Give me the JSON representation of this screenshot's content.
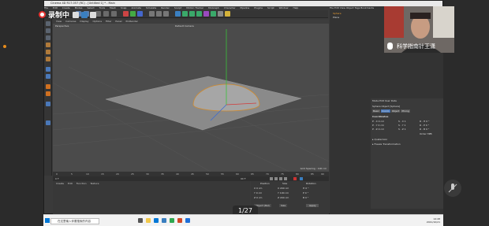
{
  "recorder": {
    "label": "录制中"
  },
  "app": {
    "title": "Cinema 4D R17.057 (RC) - [Untitled 1] * - Main",
    "menu": [
      "File",
      "Edit",
      "Create",
      "Modes",
      "Select",
      "Tools",
      "Mesh",
      "Snap",
      "Animate",
      "Simulate",
      "Render",
      "Sculpt",
      "Motion Tracker",
      "MoGraph",
      "Character",
      "Pipeline",
      "Plugins",
      "Script",
      "Window",
      "Help"
    ],
    "viewport": {
      "menu": [
        "View",
        "Cameras",
        "Display",
        "Options",
        "Filter",
        "Panel",
        "ProRender"
      ],
      "name": "Perspective",
      "camera": "Default Camera",
      "grid_spacing": "Grid Spacing : 100 cm"
    },
    "objects": {
      "header": [
        "File",
        "Edit",
        "View",
        "Object",
        "Tags",
        "Bookmarks"
      ],
      "items": [
        "Sphere",
        "Plane"
      ]
    },
    "attributes": {
      "menu": [
        "Mode",
        "Edit",
        "User Data"
      ],
      "object_label": "Sphere Object [Sphere]",
      "tabs": [
        "Basic",
        "Coord.",
        "Object",
        "Phong"
      ],
      "section": "Coordinates",
      "rows": [
        {
          "p": "P . X   0 cm",
          "s": "S . X   1",
          "r": "R . H   0 °"
        },
        {
          "p": "P . Y   0 cm",
          "s": "S . Y   1",
          "r": "R . P   0 °"
        },
        {
          "p": "P . Z   0 cm",
          "s": "S . Z   1",
          "r": "R . B   0 °"
        }
      ],
      "order": "Order  HPB",
      "quaternion": "▸ Quaternion",
      "freeze": "▸ Freeze Transformation"
    },
    "timeline": {
      "ticks": [
        "0",
        "5",
        "10",
        "15",
        "20",
        "25",
        "30",
        "35",
        "40",
        "45",
        "50",
        "55",
        "60",
        "65",
        "70",
        "75",
        "80",
        "85",
        "90"
      ],
      "start": "0 F",
      "end": "90 F"
    },
    "materials": {
      "menu": [
        "Create",
        "Edit",
        "Function",
        "Texture"
      ]
    },
    "coords": {
      "headers": [
        "Position",
        "Size",
        "Rotation"
      ],
      "rows": [
        [
          "X  0 cm",
          "X  200 cm",
          "H  0 °"
        ],
        [
          "Y  0 cm",
          "Y  100 cm",
          "P  0 °"
        ],
        [
          "Z  0 cm",
          "Z  200 cm",
          "B  0 °"
        ]
      ],
      "mode": "Object (Rel)",
      "size_mode": "Size",
      "apply": "Apply"
    }
  },
  "webcam": {
    "caption": "科学指南针王潇"
  },
  "presentation": {
    "page": "1/27"
  },
  "taskbar": {
    "search": "在这里输入你要搜索的内容",
    "time": "14:48",
    "date": "2021/10/21"
  }
}
